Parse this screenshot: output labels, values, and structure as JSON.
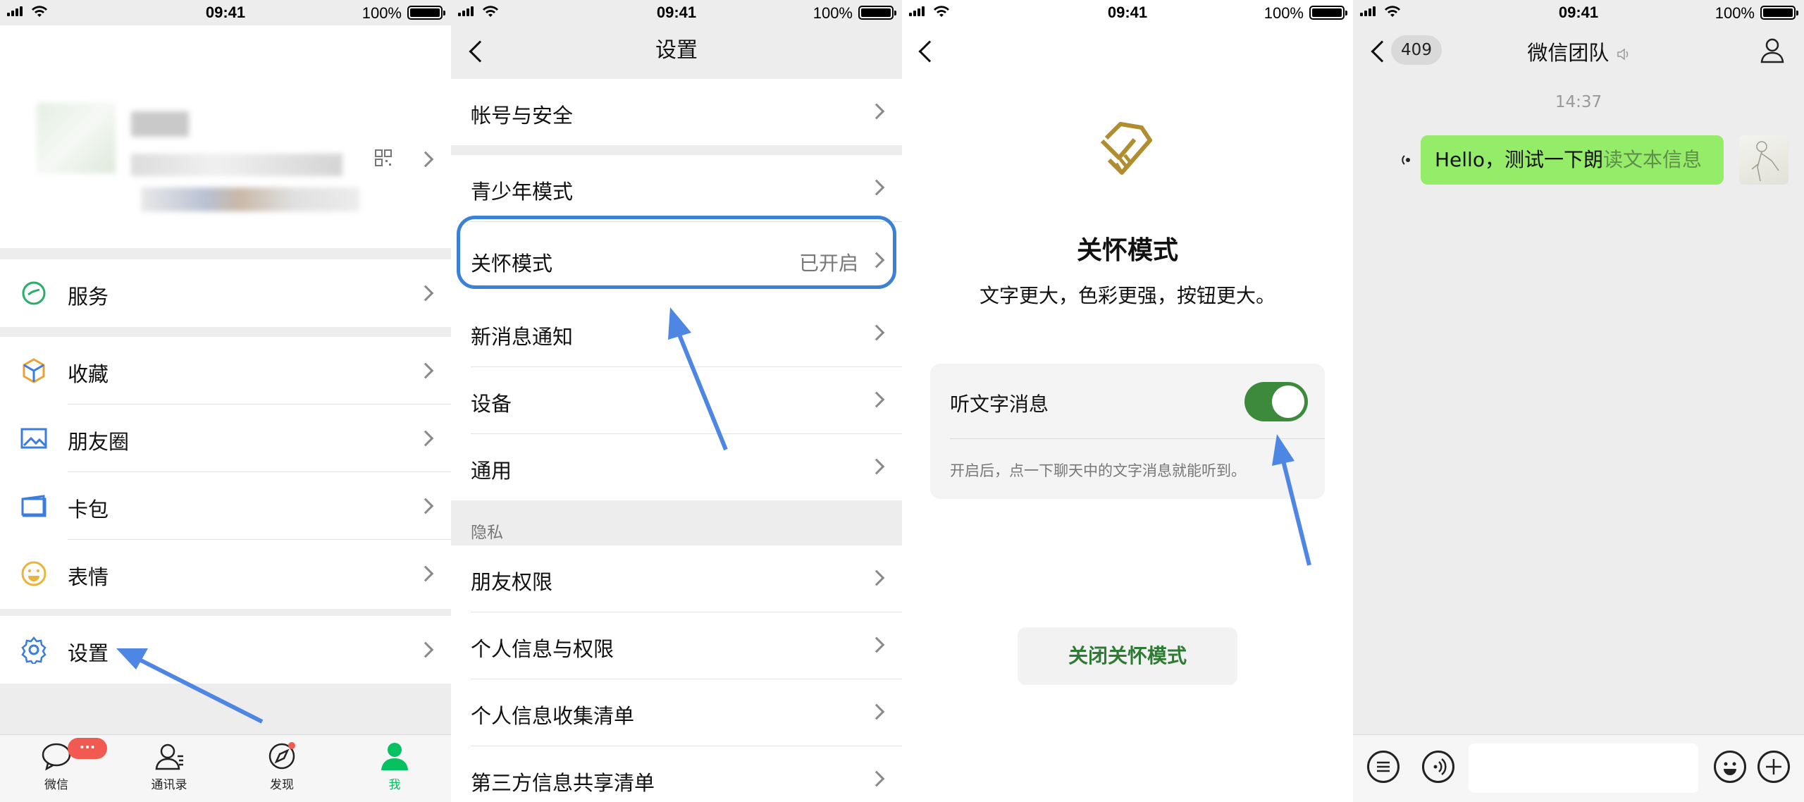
{
  "status": {
    "time": "09:41",
    "battery": "100%"
  },
  "screen1": {
    "menu": [
      "服务",
      "收藏",
      "朋友圈",
      "卡包",
      "表情",
      "设置"
    ],
    "tabs": [
      "微信",
      "通讯录",
      "发现",
      "我"
    ],
    "badge": "···"
  },
  "screen2": {
    "title": "设置",
    "item_account": "帐号与安全",
    "item_teen": "青少年模式",
    "item_care": "关怀模式",
    "item_care_value": "已开启",
    "item_notify": "新消息通知",
    "item_device": "设备",
    "item_general": "通用",
    "section_privacy": "隐私",
    "item_friends": "朋友权限",
    "item_personal": "个人信息与权限",
    "item_collect": "个人信息收集清单",
    "item_third": "第三方信息共享清单"
  },
  "screen3": {
    "title": "关怀模式",
    "subtitle": "文字更大，色彩更强，按钮更大。",
    "option_label": "听文字消息",
    "option_on": true,
    "option_desc": "开启后，点一下聊天中的文字消息就能听到。",
    "close_button": "关闭关怀模式"
  },
  "screen4": {
    "unread": "409",
    "title": "微信团队",
    "timestamp": "14:37",
    "msg_part1": "Hello，测试一下朗",
    "msg_part2": "读文本信息"
  },
  "colors": {
    "accent": "#07c160",
    "highlight": "#3b82d6",
    "arrow": "#4d86e3",
    "bubble": "#95ec69",
    "toggle": "#3d8a3d"
  }
}
